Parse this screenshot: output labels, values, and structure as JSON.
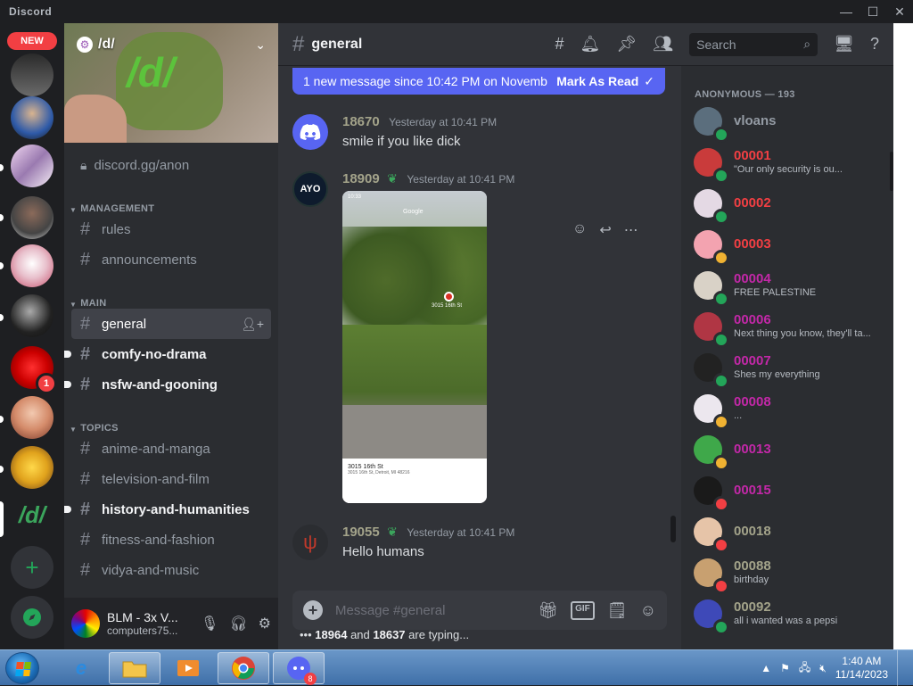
{
  "window": {
    "app_name": "Discord",
    "minimize": "—",
    "maximize": "☐",
    "close": "✕"
  },
  "rail": {
    "new_badge": "NEW",
    "badges": {
      "server_8": "1"
    },
    "server_d_label": "/d/",
    "add_label": "+",
    "explore_label": "⊘"
  },
  "server": {
    "name": "/d/",
    "banner_text": "/d/",
    "invite": "discord.gg/anon",
    "categories": {
      "management": "MANAGEMENT",
      "main": "MAIN",
      "topics": "TOPICS"
    },
    "channels": {
      "rules": "rules",
      "announcements": "announcements",
      "general": "general",
      "comfy": "comfy-no-drama",
      "nsfw": "nsfw-and-gooning",
      "anime": "anime-and-manga",
      "tv": "television-and-film",
      "history": "history-and-humanities",
      "fitness": "fitness-and-fashion",
      "vidya": "vidya-and-music"
    }
  },
  "user_panel": {
    "name": "BLM - 3x V...",
    "sub": "computers75..."
  },
  "chat": {
    "channel_title": "general",
    "search_placeholder": "Search",
    "new_messages": "1 new message since 10:42 PM on Novemb...",
    "mark_as_read": "Mark As Read",
    "messages": [
      {
        "user": "18670",
        "time": "Yesterday at 10:41 PM",
        "body": "smile if you like dick",
        "color": "#a3a38a"
      },
      {
        "user": "18909",
        "time": "Yesterday at 10:41 PM",
        "body": "",
        "color": "#a3a38a",
        "attachment": {
          "address": "3015 16th St",
          "sub": "3015 16th St, Detroit, MI 48216",
          "pin_label": "3015 16th St",
          "status_time": "10:33",
          "app": "Google"
        }
      },
      {
        "user": "19055",
        "time": "Yesterday at 10:41 PM",
        "body": "Hello humans",
        "color": "#a3a38a"
      }
    ],
    "composer_placeholder": "Message #general",
    "gif_label": "GIF",
    "typing": {
      "user_a": "18964",
      "joiner": "and",
      "user_b": "18637",
      "suffix": "are typing..."
    }
  },
  "members": {
    "category": "ANONYMOUS — 193",
    "list": [
      {
        "name": "vloans",
        "status": "",
        "color": "#949ba4",
        "presence": "#23a559",
        "avatar": "#5b6e7d"
      },
      {
        "name": "00001",
        "status": "\"Our only security is ou...",
        "color": "#f23f43",
        "presence": "#23a559",
        "avatar": "#c93b3b"
      },
      {
        "name": "00002",
        "status": "",
        "color": "#f23f43",
        "presence": "#23a559",
        "avatar": "#e4d9e4"
      },
      {
        "name": "00003",
        "status": "",
        "color": "#f23f43",
        "presence": "#f0b232",
        "avatar": "#f3a3b0"
      },
      {
        "name": "00004",
        "status": "FREE PALESTINE",
        "color": "#c328a8",
        "presence": "#23a559",
        "avatar": "#d9d2c7"
      },
      {
        "name": "00006",
        "status": "Next thing you know, they'll ta...",
        "color": "#c328a8",
        "presence": "#23a559",
        "avatar": "#b03644"
      },
      {
        "name": "00007",
        "status": "Shes my everything",
        "color": "#c328a8",
        "presence": "#23a559",
        "avatar": "#222"
      },
      {
        "name": "00008",
        "status": "...",
        "color": "#c328a8",
        "presence": "#f0b232",
        "avatar": "#ece7ee"
      },
      {
        "name": "00013",
        "status": "",
        "color": "#c328a8",
        "presence": "#f0b232",
        "avatar": "#3fa84a"
      },
      {
        "name": "00015",
        "status": "",
        "color": "#c328a8",
        "presence": "#f23f43",
        "avatar": "#1a1a1a"
      },
      {
        "name": "00018",
        "status": "",
        "color": "#a3a38a",
        "presence": "#f23f43",
        "avatar": "#e6c4a8"
      },
      {
        "name": "00088",
        "status": "birthday",
        "color": "#a3a38a",
        "presence": "#f23f43",
        "avatar": "#c8a070"
      },
      {
        "name": "00092",
        "status": "all i wanted was a pepsi",
        "color": "#a3a38a",
        "presence": "#23a559",
        "avatar": "#3e49b8"
      }
    ]
  },
  "taskbar": {
    "time": "1:40 AM",
    "date": "11/14/2023",
    "discord_badge": "8"
  }
}
